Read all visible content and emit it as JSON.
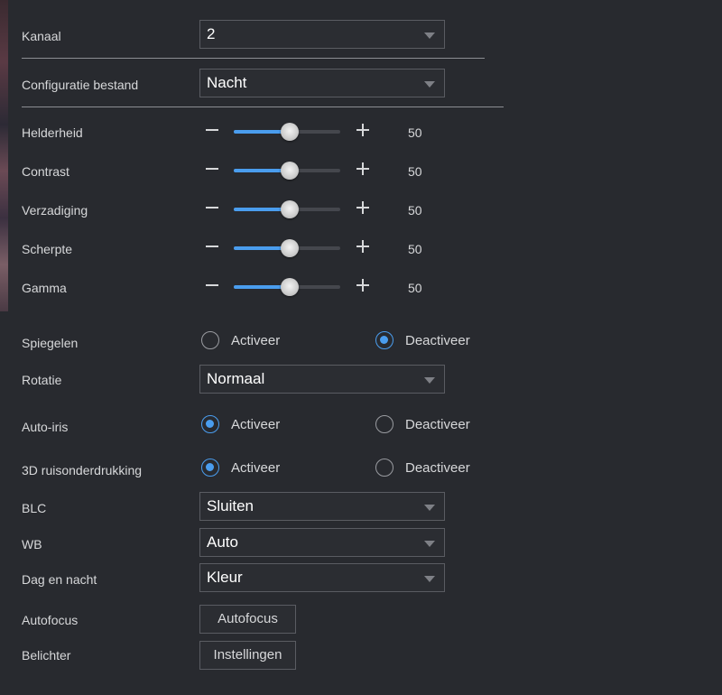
{
  "kanaal": {
    "label": "Kanaal",
    "value": "2"
  },
  "configuratie": {
    "label": "Configuratie bestand",
    "value": "Nacht"
  },
  "sliders": [
    {
      "label": "Helderheid",
      "value": "50",
      "level_percent": 50
    },
    {
      "label": "Contrast",
      "value": "50",
      "level_percent": 50
    },
    {
      "label": "Verzadiging",
      "value": "50",
      "level_percent": 50
    },
    {
      "label": "Scherpte",
      "value": "50",
      "level_percent": 50
    },
    {
      "label": "Gamma",
      "value": "50",
      "level_percent": 50
    }
  ],
  "spiegelen": {
    "label": "Spiegelen",
    "on_label": "Activeer",
    "off_label": "Deactiveer",
    "selected": "off"
  },
  "rotatie": {
    "label": "Rotatie",
    "value": "Normaal"
  },
  "auto_iris": {
    "label": "Auto-iris",
    "on_label": "Activeer",
    "off_label": "Deactiveer",
    "selected": "on"
  },
  "ruisonderdrukking": {
    "label": "3D ruisonderdrukking",
    "on_label": "Activeer",
    "off_label": "Deactiveer",
    "selected": "on"
  },
  "blc": {
    "label": "BLC",
    "value": "Sluiten"
  },
  "wb": {
    "label": "WB",
    "value": "Auto"
  },
  "dag_nacht": {
    "label": "Dag en nacht",
    "value": "Kleur"
  },
  "autofocus": {
    "label": "Autofocus",
    "button_label": "Autofocus"
  },
  "belichter": {
    "label": "Belichter",
    "button_label": "Instellingen"
  },
  "colors": {
    "accent": "#4a9dee",
    "background": "#282a2f",
    "border": "#5a5c62"
  },
  "icons": {
    "minus": "minus-icon",
    "plus": "plus-icon",
    "dropdown": "chevron-down-icon"
  }
}
